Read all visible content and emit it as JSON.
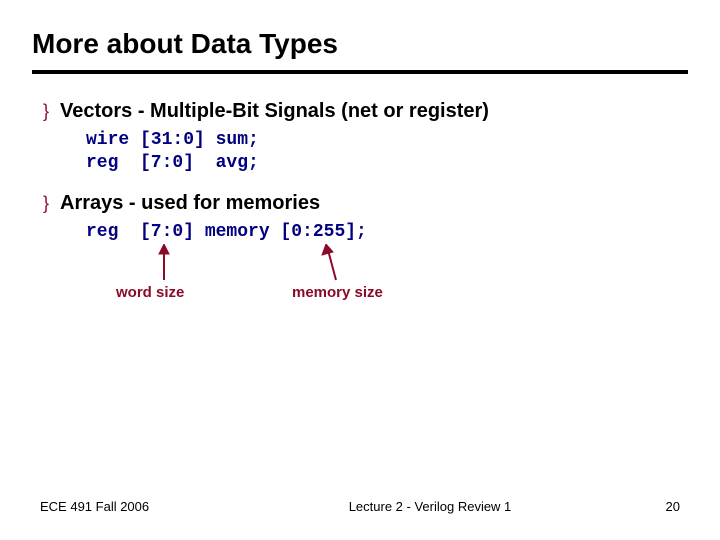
{
  "title": "More about Data Types",
  "bullets": [
    {
      "text": "Vectors - Multiple-Bit Signals (net or register)",
      "code": "wire [31:0] sum;\nreg  [7:0]  avg;"
    },
    {
      "text": "Arrays - used for memories",
      "code": "reg  [7:0] memory [0:255];"
    }
  ],
  "annotations": {
    "word_size": "word size",
    "memory_size": "memory size"
  },
  "footer": {
    "left": "ECE 491 Fall 2006",
    "center": "Lecture 2 - Verilog Review 1",
    "right": "20"
  }
}
